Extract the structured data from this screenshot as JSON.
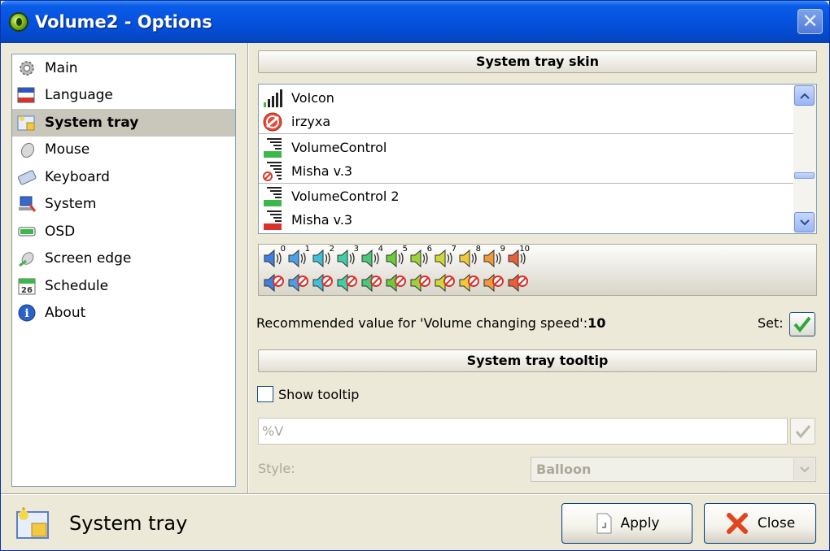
{
  "window": {
    "title": "Volume2 - Options",
    "close_glyph": "✕"
  },
  "sidebar": {
    "items": [
      {
        "label": "Main",
        "icon": "gear-icon"
      },
      {
        "label": "Language",
        "icon": "flag-icon"
      },
      {
        "label": "System tray",
        "icon": "system-tray-icon",
        "selected": true
      },
      {
        "label": "Mouse",
        "icon": "mouse-icon"
      },
      {
        "label": "Keyboard",
        "icon": "keyboard-icon"
      },
      {
        "label": "System",
        "icon": "computer-icon"
      },
      {
        "label": "OSD",
        "icon": "osd-icon"
      },
      {
        "label": "Screen edge",
        "icon": "screen-edge-icon"
      },
      {
        "label": "Schedule",
        "icon": "calendar-icon",
        "badge": "26"
      },
      {
        "label": "About",
        "icon": "info-icon",
        "badge": "i"
      }
    ]
  },
  "skin_section": {
    "header": "System tray skin",
    "list": [
      {
        "label": "VoIcon",
        "icon": "signal-bars-icon"
      },
      {
        "label": "irzyxa",
        "icon": "no-entry-icon"
      },
      {
        "label": "VolumeControl",
        "icon": "volume-green-icon"
      },
      {
        "label": "Misha v.3",
        "icon": "volume-muted-icon"
      },
      {
        "label": "VolumeControl 2",
        "icon": "volume-green-icon"
      },
      {
        "label": "Misha v.3",
        "icon": "volume-red-icon"
      }
    ],
    "preview_levels": [
      "0",
      "1",
      "2",
      "3",
      "4",
      "5",
      "6",
      "7",
      "8",
      "9",
      "10"
    ],
    "preview_colors": [
      "#3f7fe0",
      "#4aa0e8",
      "#3fc0d8",
      "#3fcfa8",
      "#48c878",
      "#6ccb3a",
      "#9fd23a",
      "#cfd83a",
      "#f0c83a",
      "#f09a3a",
      "#e8603a"
    ],
    "recommended_text": "Recommended value for 'Volume changing speed':",
    "recommended_value": "10",
    "set_label": "Set:"
  },
  "tooltip_section": {
    "header": "System tray tooltip",
    "show_tooltip_label": "Show tooltip",
    "show_tooltip_checked": false,
    "tooltip_value": "%V",
    "style_label": "Style:",
    "style_value": "Balloon"
  },
  "footer": {
    "title": "System tray",
    "apply_label": "Apply",
    "close_label": "Close"
  }
}
